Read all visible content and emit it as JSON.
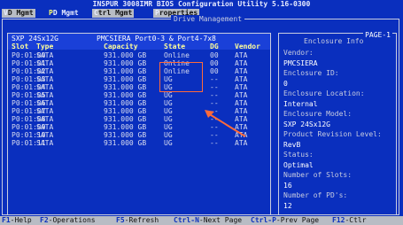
{
  "title": "INSPUR 3008IMR BIOS Configuration Utility 5.16-0300",
  "tabs": [
    {
      "hot": "V",
      "rest": "D Mgmt",
      "active": false
    },
    {
      "hot": "P",
      "rest": "D Mgmt",
      "active": true
    },
    {
      "hot": "C",
      "rest": "trl Mgmt",
      "active": false
    },
    {
      "hot": "P",
      "rest": "roperties",
      "active": false
    }
  ],
  "panel_title": "Drive Management",
  "group": {
    "enclosure": "SXP 24Sx12G",
    "ports": "PMCSIERA Port0-3 & Port4-7x8"
  },
  "columns": [
    "Slot",
    "Type",
    "Capacity",
    "State",
    "DG",
    "Vendor"
  ],
  "rows": [
    {
      "slot": "P0:01:00",
      "type": "SATA",
      "capacity": "931.000 GB",
      "state": "Online",
      "dg": "00",
      "vendor": "ATA"
    },
    {
      "slot": "P0:01:01",
      "type": "SATA",
      "capacity": "931.000 GB",
      "state": "Online",
      "dg": "00",
      "vendor": "ATA"
    },
    {
      "slot": "P0:01:02",
      "type": "SATA",
      "capacity": "931.000 GB",
      "state": "Online",
      "dg": "00",
      "vendor": "ATA"
    },
    {
      "slot": "P0:01:03",
      "type": "SATA",
      "capacity": "931.000 GB",
      "state": "UG",
      "dg": "--",
      "vendor": "ATA"
    },
    {
      "slot": "P0:01:04",
      "type": "SATA",
      "capacity": "931.000 GB",
      "state": "UG",
      "dg": "--",
      "vendor": "ATA"
    },
    {
      "slot": "P0:01:05",
      "type": "SATA",
      "capacity": "931.000 GB",
      "state": "UG",
      "dg": "--",
      "vendor": "ATA"
    },
    {
      "slot": "P0:01:06",
      "type": "SATA",
      "capacity": "931.000 GB",
      "state": "UG",
      "dg": "--",
      "vendor": "ATA"
    },
    {
      "slot": "P0:01:07",
      "type": "SATA",
      "capacity": "931.000 GB",
      "state": "UG",
      "dg": "--",
      "vendor": "ATA"
    },
    {
      "slot": "P0:01:08",
      "type": "SATA",
      "capacity": "931.000 GB",
      "state": "UG",
      "dg": "--",
      "vendor": "ATA"
    },
    {
      "slot": "P0:01:09",
      "type": "SATA",
      "capacity": "931.000 GB",
      "state": "UG",
      "dg": "--",
      "vendor": "ATA"
    },
    {
      "slot": "P0:01:10",
      "type": "SATA",
      "capacity": "931.000 GB",
      "state": "UG",
      "dg": "--",
      "vendor": "ATA"
    },
    {
      "slot": "P0:01:11",
      "type": "SATA",
      "capacity": "931.000 GB",
      "state": "UG",
      "dg": "--",
      "vendor": "ATA"
    }
  ],
  "info": {
    "page": "PAGE-1",
    "title": "Enclosure Info",
    "lines": [
      {
        "text": "Vendor:",
        "kind": "label"
      },
      {
        "text": "PMCSIERA",
        "kind": "value"
      },
      {
        "text": "Enclosure ID:",
        "kind": "label"
      },
      {
        "text": "0",
        "kind": "value"
      },
      {
        "text": "Enclosure Location:",
        "kind": "label"
      },
      {
        "text": "Internal",
        "kind": "value"
      },
      {
        "text": "Enclosure Model:",
        "kind": "label"
      },
      {
        "text": "SXP 24Sx12G",
        "kind": "value"
      },
      {
        "text": "Product Revision Level:",
        "kind": "label"
      },
      {
        "text": "RevB",
        "kind": "value"
      },
      {
        "text": "Status:",
        "kind": "label"
      },
      {
        "text": "Optimal",
        "kind": "value"
      },
      {
        "text": "Number of Slots:",
        "kind": "label"
      },
      {
        "text": "16",
        "kind": "value"
      },
      {
        "text": "Number of PD's:",
        "kind": "label"
      },
      {
        "text": "12",
        "kind": "value"
      }
    ]
  },
  "footer": [
    {
      "key": "F1",
      "label": "-Help"
    },
    {
      "key": "F2",
      "label": "-Operations"
    },
    {
      "key": "F5",
      "label": "-Refresh"
    },
    {
      "key": "Ctrl-N",
      "label": "-Next Page"
    },
    {
      "key": "Ctrl-P",
      "label": "-Prev Page"
    },
    {
      "key": "F12",
      "label": "-Ctlr"
    }
  ],
  "colors": {
    "background": "#0a2fbe",
    "menubar": "#b8bcc4",
    "highlight_box": "#ff6a3a"
  }
}
